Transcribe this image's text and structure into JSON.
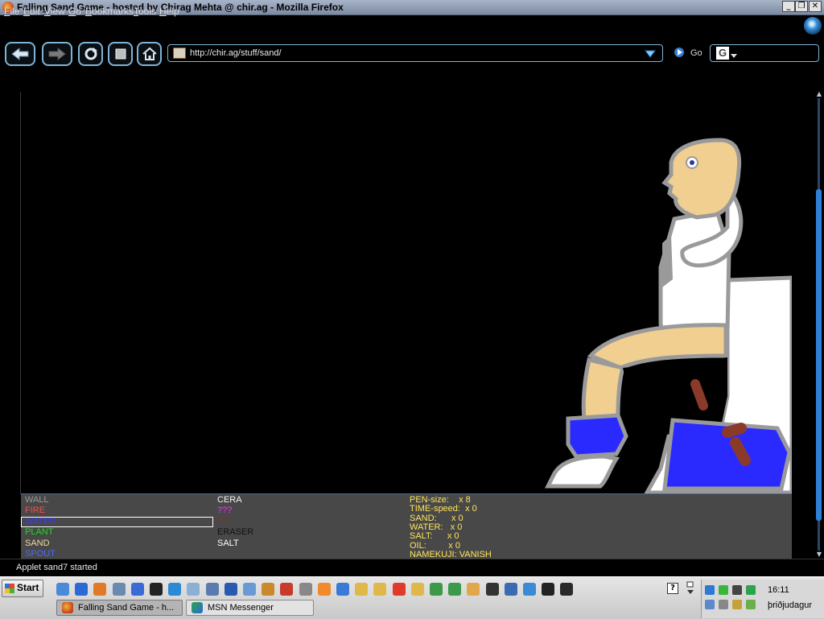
{
  "window": {
    "title": "Falling Sand Game - hosted by Chirag Mehta @ chir.ag - Mozilla Firefox",
    "controls": {
      "minimize": "_",
      "restore": "❐",
      "close": "✕"
    }
  },
  "menubar": {
    "items": [
      {
        "underline": "F",
        "rest": "ile"
      },
      {
        "underline": "E",
        "rest": "dit"
      },
      {
        "underline": "V",
        "rest": "iew"
      },
      {
        "underline": "G",
        "rest": "o"
      },
      {
        "underline": "B",
        "rest": "ookmarks"
      },
      {
        "underline": "T",
        "rest": "ools"
      },
      {
        "underline": "H",
        "rest": "elp"
      }
    ]
  },
  "toolbar": {
    "back_icon": "back-arrow-icon",
    "forward_icon": "forward-arrow-icon",
    "reload_icon": "reload-icon",
    "stop_icon": "stop-icon",
    "home_icon": "home-icon",
    "url": "http://chir.ag/stuff/sand/",
    "go_label": "Go",
    "search_engine_glyph": "G"
  },
  "applet": {
    "elements_col1": [
      {
        "label": "WALL",
        "color": "#9a9a9a"
      },
      {
        "label": "FIRE",
        "color": "#ff4a4a"
      },
      {
        "label": "WATER",
        "color": "#3a3aff",
        "selected": true
      },
      {
        "label": "PLANT",
        "color": "#1fd61f"
      },
      {
        "label": "SAND",
        "color": "#f2d9a0"
      },
      {
        "label": "SPOUT",
        "color": "#4a6aff"
      }
    ],
    "elements_col2": [
      {
        "label": "CERA",
        "color": "#f4f4f4"
      },
      {
        "label": "???",
        "color": "#ff2aff"
      },
      {
        "label": "OIL",
        "color": "#6a3a30"
      },
      {
        "label": "ERASER",
        "color": "#111111"
      },
      {
        "label": "SALT",
        "color": "#ffffff"
      }
    ],
    "stats": [
      "PEN-size:    x 8",
      "TIME-speed:  x 0",
      "SAND:      x 0",
      "WATER:   x 0",
      "SALT:      x 0",
      "OIL:         x 0",
      "NAMEKUJI: VANISH"
    ],
    "canvas_colors": {
      "skin": "#f0cf90",
      "outline": "#9a9a9a",
      "shirt": "#ffffff",
      "pants": "#2a2aff",
      "spot": "#8a3a2a",
      "eye": "#2a3aa0"
    }
  },
  "statusbar": {
    "text": "Applet sand7 started"
  },
  "taskbar": {
    "start_label": "Start",
    "quick_launch": [
      "ie-settings-icon",
      "ie-icon",
      "firefox-icon",
      "window-icon",
      "media-player-icon",
      "cmd-icon",
      "ie-blue-icon",
      "notepad-icon",
      "network-icon",
      "word-icon",
      "app-icon",
      "utility-icon",
      "app-red-icon",
      "speaker-icon",
      "orange-icon",
      "flight-icon",
      "folder-icon",
      "folder-icon",
      "flash-icon",
      "folder-icon",
      "msn-icon",
      "msn-icon",
      "clock-icon",
      "steam-icon",
      "pen-icon",
      "globe-icon",
      "media-icon",
      "winamp-icon"
    ],
    "tasks": [
      {
        "label": "Falling Sand Game - h...",
        "active": true
      },
      {
        "label": "MSN Messenger",
        "active": false
      }
    ],
    "clock": "16:11",
    "day": "þriðjudagur",
    "help_glyph": "?"
  }
}
